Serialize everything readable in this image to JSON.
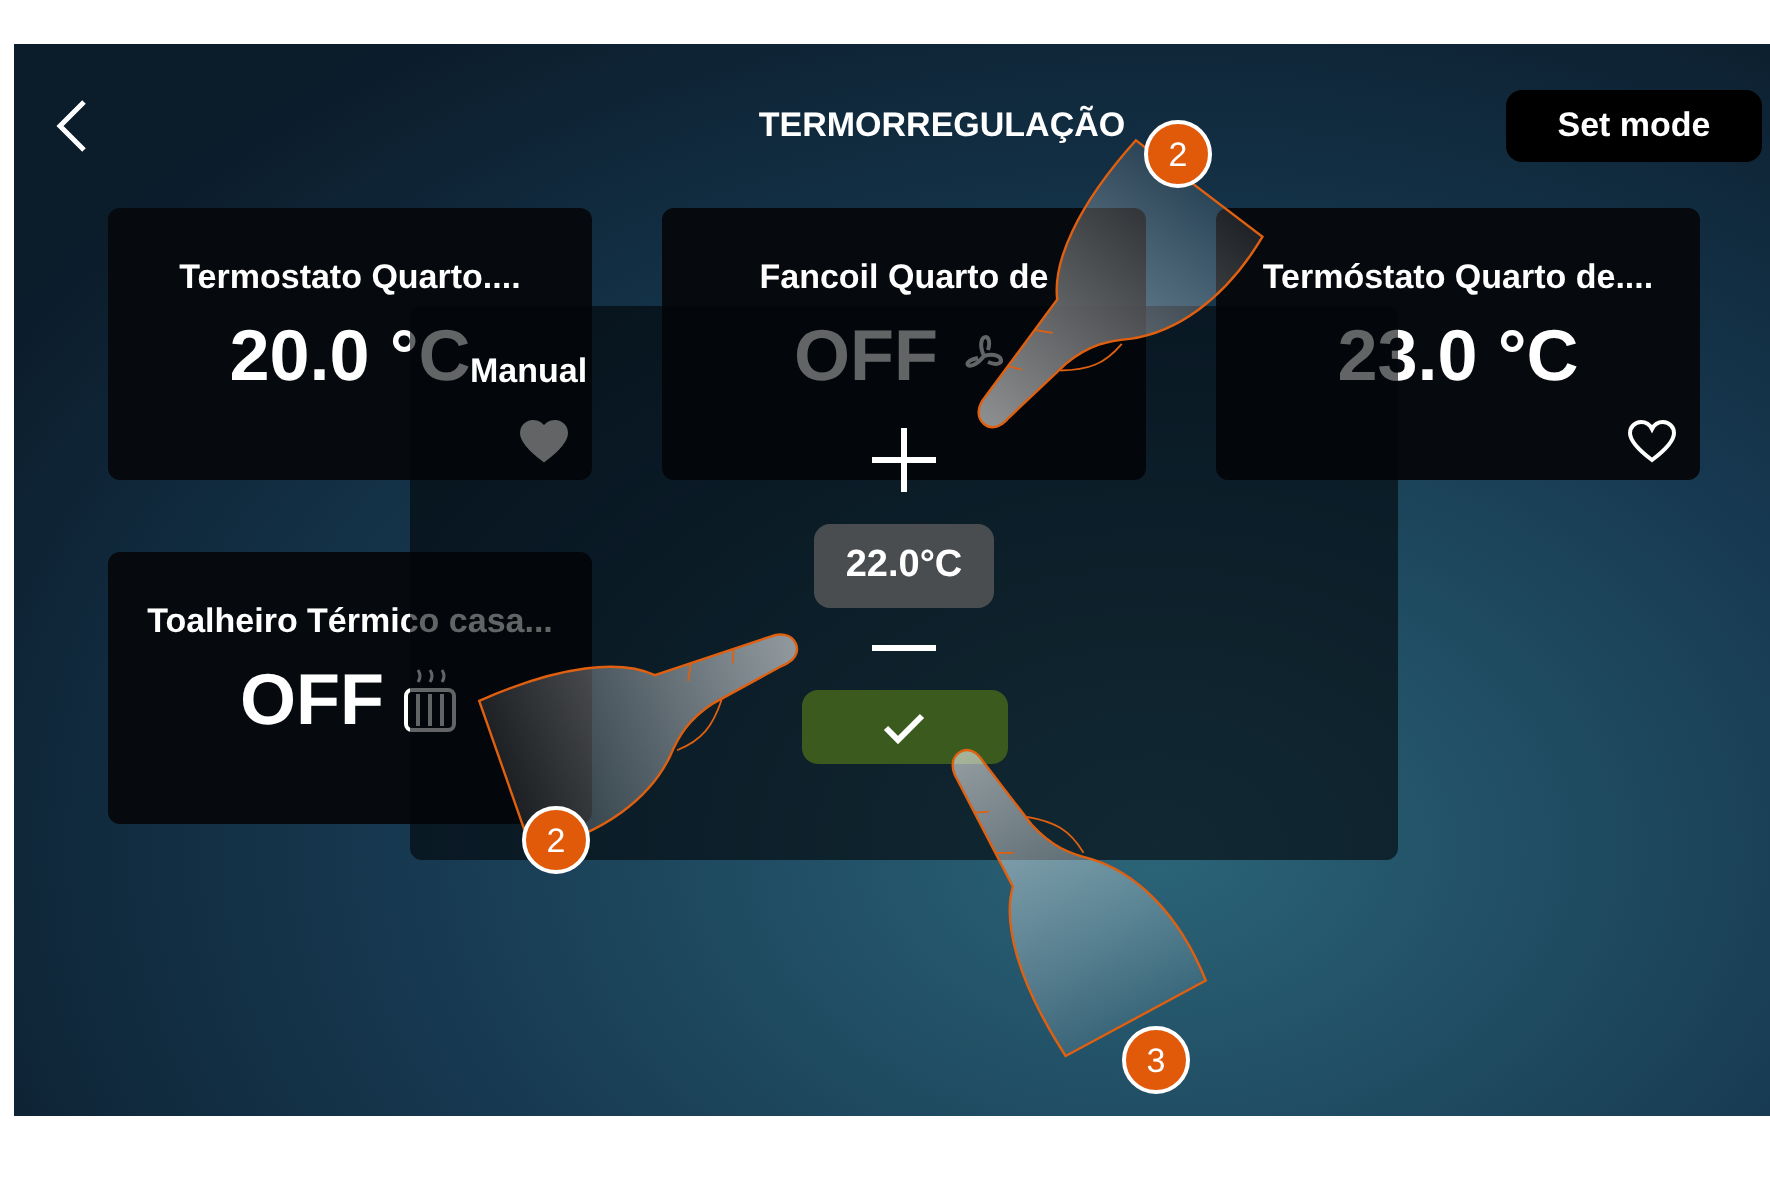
{
  "header": {
    "title": "TERMORREGULAÇÃO",
    "set_mode_button": "Set mode"
  },
  "cards": [
    {
      "kind": "thermostat",
      "title": "Termostato Quarto....",
      "value": "20.0 °C",
      "favorite": true
    },
    {
      "kind": "fancoil",
      "title": "Fancoil Quarto de",
      "value": "OFF"
    },
    {
      "kind": "thermostat",
      "title": "Termóstato Quarto de....",
      "value": "23.0 °C",
      "favorite": false
    },
    {
      "kind": "towel_warmer",
      "title": "Toalheiro Térmico casa...",
      "value": "OFF"
    }
  ],
  "dialog": {
    "mode": "Manual",
    "setpoint": "22.0°C"
  },
  "callouts": [
    {
      "number": "2",
      "kind": "plus"
    },
    {
      "number": "2",
      "kind": "minus"
    },
    {
      "number": "3",
      "kind": "confirm"
    }
  ]
}
